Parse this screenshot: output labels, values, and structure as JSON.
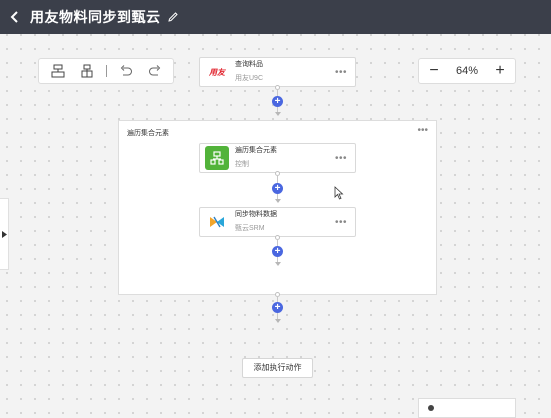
{
  "header": {
    "title": "用友物料同步到甄云",
    "back_icon": "chevron-left-icon",
    "edit_icon": "pencil-icon"
  },
  "toolbar": {
    "icons": [
      "node-align-icon",
      "node-branch-icon",
      "undo-icon",
      "redo-icon"
    ]
  },
  "zoom": {
    "minus": "−",
    "value": "64%",
    "plus": "+"
  },
  "nodes": {
    "query": {
      "name": "查询料品",
      "sub": "用友U9C",
      "logo_text": "用友",
      "logo_color": "#e1252f"
    },
    "loop": {
      "title": "遍历集合元素"
    },
    "loop_item": {
      "name": "遍历集合元素",
      "sub": "控制",
      "logo_color": "#52b33a"
    },
    "sync": {
      "name": "同步物料数据",
      "sub": "甄云SRM"
    }
  },
  "more_label": "•••",
  "add_action": "添加执行动作",
  "accent": "#4a67e0"
}
